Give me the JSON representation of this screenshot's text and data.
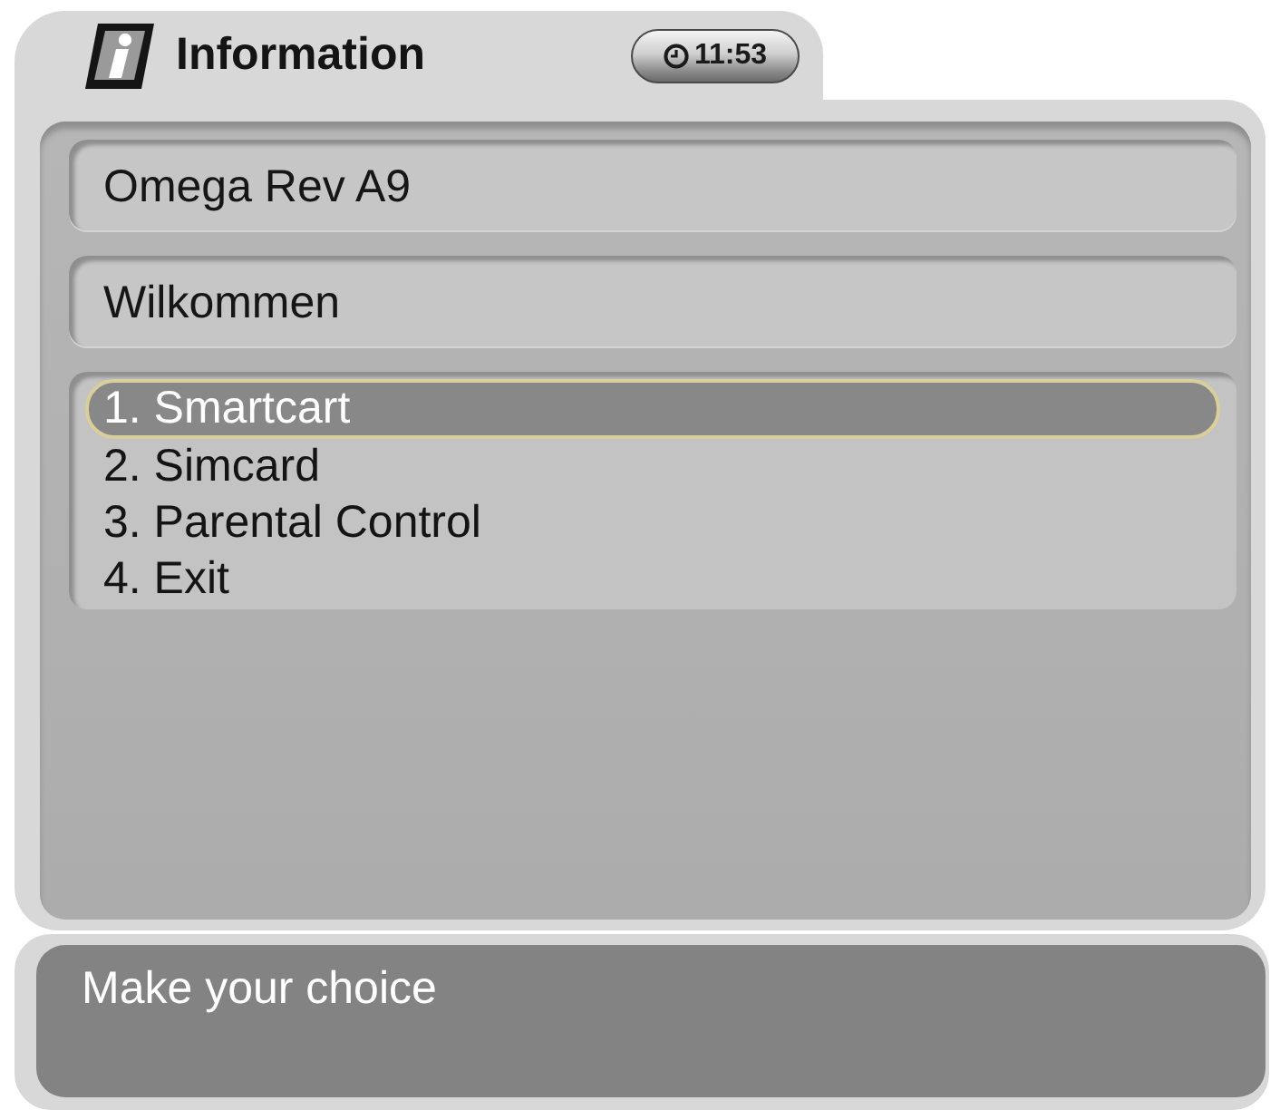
{
  "header": {
    "title": "Information",
    "clock": "11:53"
  },
  "panels": [
    {
      "text": "Omega Rev A9"
    },
    {
      "text": "Wilkommen"
    }
  ],
  "menu": {
    "items": [
      {
        "label": "1. Smartcart",
        "selected": true
      },
      {
        "label": "2. Simcard",
        "selected": false
      },
      {
        "label": "3. Parental Control",
        "selected": false
      },
      {
        "label": "4. Exit",
        "selected": false
      }
    ]
  },
  "status_bar": {
    "message": "Make your choice"
  }
}
